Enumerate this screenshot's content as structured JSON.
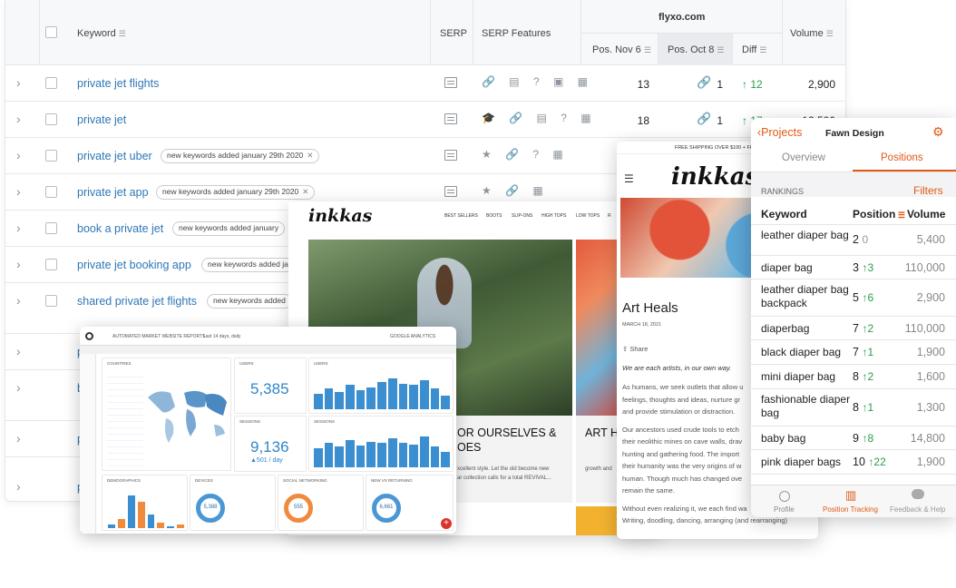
{
  "keyword_table": {
    "headers": {
      "keyword": "Keyword",
      "serp": "SERP",
      "serp_features": "SERP Features",
      "domain": "flyxo.com",
      "pos_nov": "Pos. Nov 6",
      "pos_oct": "Pos. Oct 8",
      "diff": "Diff",
      "volume": "Volume"
    },
    "rows": [
      {
        "keyword": "private jet flights",
        "tag": "",
        "features": "🔗 ▤ ? ▣ ▦",
        "pos_nov": "13",
        "pos_oct": "1",
        "diff": "↑ 12",
        "volume": "2,900"
      },
      {
        "keyword": "private jet",
        "tag": "",
        "features": "🎓 🔗 ▤ ? ▦",
        "pos_nov": "18",
        "pos_oct": "1",
        "diff": "↑ 17",
        "volume": "12,500"
      },
      {
        "keyword": "private jet uber",
        "tag": "new keywords added january 29th 2020",
        "features": "★ 🔗 ? ▦"
      },
      {
        "keyword": "private jet app",
        "tag": "new keywords added january 29th 2020",
        "features": "★ 🔗 ▦"
      },
      {
        "keyword": "book a private jet",
        "tag": "new keywords added january"
      },
      {
        "keyword": "private jet booking app",
        "tag": "new keywords added ja"
      },
      {
        "keyword": "shared private jet flights",
        "tag": "new keywords added"
      },
      {
        "keyword": "p",
        "tag": ""
      },
      {
        "keyword": "b",
        "tag": ""
      },
      {
        "keyword": "p",
        "tag": ""
      },
      {
        "keyword": "p",
        "tag": ""
      }
    ]
  },
  "dashboard": {
    "title": "AUTOMATED MARKET WEBSITE REPORTS",
    "date_range": "Last 14 days, daily",
    "source": "GOOGLE ANALYTICS",
    "cards": {
      "countries": "COUNTRIES",
      "users": "USERS",
      "users_value": "5,385",
      "sessions": "SESSIONS",
      "sessions_value": "9,136",
      "sessions_sub": "▲501 / day",
      "demographics": "DEMOGRAPHICS",
      "devices": "DEVICES",
      "devices_value": "5,388",
      "social": "SOCIAL NETWORKING",
      "social_value": "555",
      "new_returning": "NEW VS RETURNING",
      "new_returning_value": "6,661"
    },
    "bars_users": [
      0.45,
      0.6,
      0.5,
      0.7,
      0.55,
      0.62,
      0.8,
      0.9,
      0.75,
      0.7,
      0.85,
      0.6,
      0.4
    ],
    "bars_sessions": [
      0.55,
      0.7,
      0.6,
      0.8,
      0.62,
      0.75,
      0.7,
      0.85,
      0.72,
      0.65,
      0.9,
      0.6,
      0.45
    ],
    "bars_demo": [
      0.1,
      0.25,
      0.85,
      0.7,
      0.35,
      0.15,
      0.05,
      0.1
    ]
  },
  "inkkas_site": {
    "logo": "inkkas",
    "nav": [
      "BEST SELLERS",
      "BOOTS",
      "SLIP-ONS",
      "HIGH TOPS",
      "LOW TOPS",
      "R"
    ],
    "headline1": "OR OURSELVES &",
    "headline2": "OES",
    "headline3": "ART H",
    "body1": "xcellent style. Let the old become new",
    "body2": "ar collection calls for a total REVIVAL...",
    "body3": "growth and"
  },
  "mobile_site": {
    "shipping": "FREE SHIPPING OVER $100 + FREE",
    "logo": "inkkas",
    "title": "Art Heals",
    "date": "MARCH 18, 2021",
    "share": "Share",
    "intro": "We are each artists, in our own way.",
    "lines": [
      "As humans, we seek outlets that allow u",
      "feelings, thoughts and ideas, nurture gr",
      "and provide stimulation or distraction.",
      "",
      "Our ancestors used crude tools to etch",
      "their neolithic mines on cave walls, drav",
      "hunting and gathering food. The import",
      "their humanity was the very origins of w",
      "human. Though much has changed ove",
      "remain the same.",
      "",
      "Without even realizing it, we each find wa",
      "Writing, doodling, dancing, arranging (and rearranging)"
    ]
  },
  "app": {
    "back": "Projects",
    "title": "Fawn Design",
    "tab_overview": "Overview",
    "tab_positions": "Positions",
    "section": "RANKINGS",
    "filters": "Filters",
    "col_keyword": "Keyword",
    "col_position": "Position",
    "col_volume": "Volume",
    "rows": [
      {
        "keyword": "leather diaper bag",
        "pos": "2",
        "change": "0",
        "dir": "none",
        "volume": "5,400"
      },
      {
        "keyword": "diaper bag",
        "pos": "3",
        "change": "↑3",
        "dir": "up",
        "volume": "110,000"
      },
      {
        "keyword": "leather diaper bag backpack",
        "pos": "5",
        "change": "↑6",
        "dir": "up",
        "volume": "2,900"
      },
      {
        "keyword": "diaperbag",
        "pos": "7",
        "change": "↑2",
        "dir": "up",
        "volume": "110,000"
      },
      {
        "keyword": "black diaper bag",
        "pos": "7",
        "change": "↑1",
        "dir": "up",
        "volume": "1,900"
      },
      {
        "keyword": "mini diaper bag",
        "pos": "8",
        "change": "↑2",
        "dir": "up",
        "volume": "1,600"
      },
      {
        "keyword": "fashionable diaper bag",
        "pos": "8",
        "change": "↑1",
        "dir": "up",
        "volume": "1,300"
      },
      {
        "keyword": "baby bag",
        "pos": "9",
        "change": "↑8",
        "dir": "up",
        "volume": "14,800"
      },
      {
        "keyword": "pink diaper bags",
        "pos": "10",
        "change": "↑22",
        "dir": "up",
        "volume": "1,900"
      }
    ],
    "bottom_tabs": [
      "Profile",
      "Position Tracking",
      "Feedback & Help"
    ],
    "accent": "#e05a16"
  }
}
